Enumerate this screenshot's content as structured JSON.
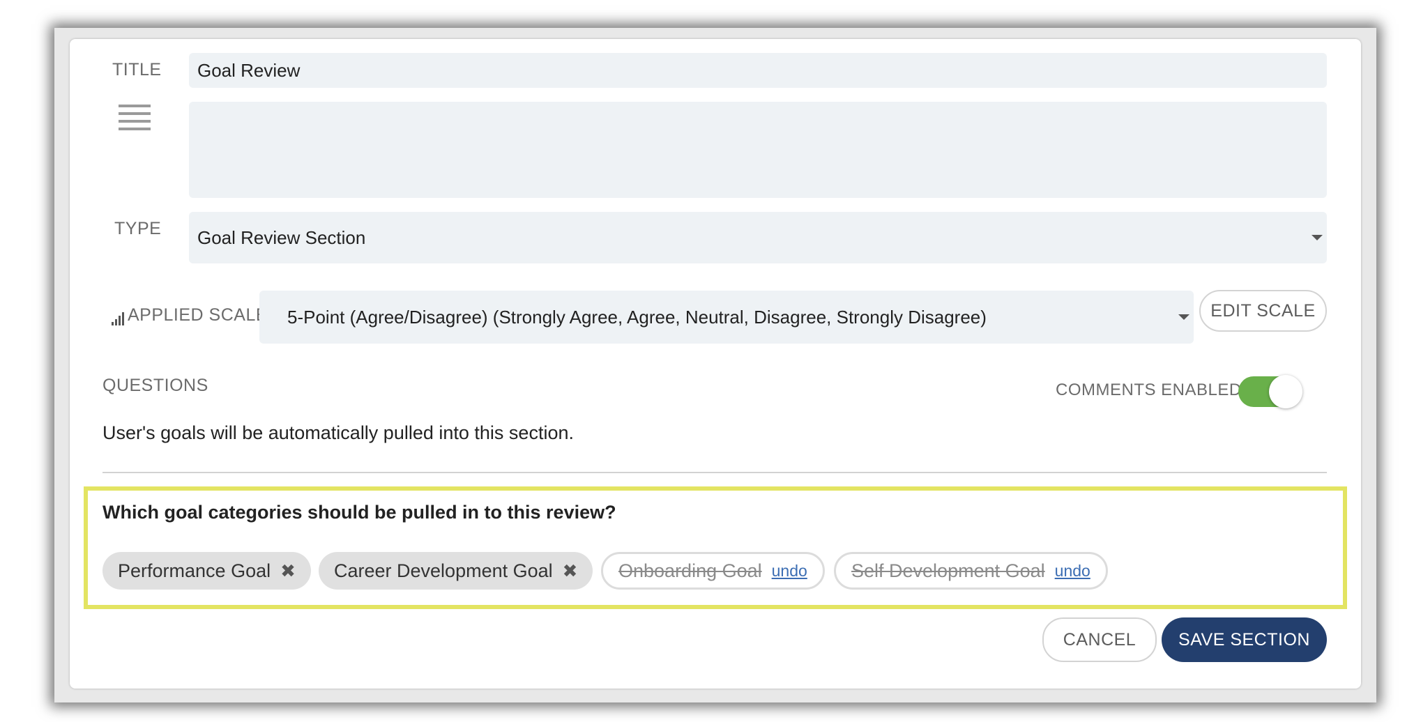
{
  "form": {
    "title_label": "TITLE",
    "title_value": "Goal Review",
    "description_value": "",
    "type_label": "TYPE",
    "type_value": "Goal Review Section",
    "scale_label": "APPLIED SCALE",
    "scale_value": "5-Point (Agree/Disagree) (Strongly Agree, Agree, Neutral, Disagree, Strongly Disagree)",
    "edit_scale_label": "EDIT SCALE",
    "questions_label": "QUESTIONS",
    "comments_label": "COMMENTS ENABLED",
    "comments_enabled": true,
    "info_text": "User's goals will be automatically pulled into this section."
  },
  "categories": {
    "question": "Which goal categories should be pulled in to this review?",
    "chips": [
      {
        "label": "Performance Goal",
        "state": "active",
        "action": "✖"
      },
      {
        "label": "Career Development Goal",
        "state": "active",
        "action": "✖"
      },
      {
        "label": "Onboarding Goal",
        "state": "removed",
        "action": "undo"
      },
      {
        "label": "Self Development Goal",
        "state": "removed",
        "action": "undo"
      }
    ]
  },
  "actions": {
    "cancel_label": "CANCEL",
    "save_label": "SAVE SECTION"
  },
  "colors": {
    "primary": "#233f6e",
    "toggle_on": "#69b04a",
    "highlight": "#e3e462",
    "field_bg": "#eef2f5",
    "link": "#3b6db3"
  }
}
